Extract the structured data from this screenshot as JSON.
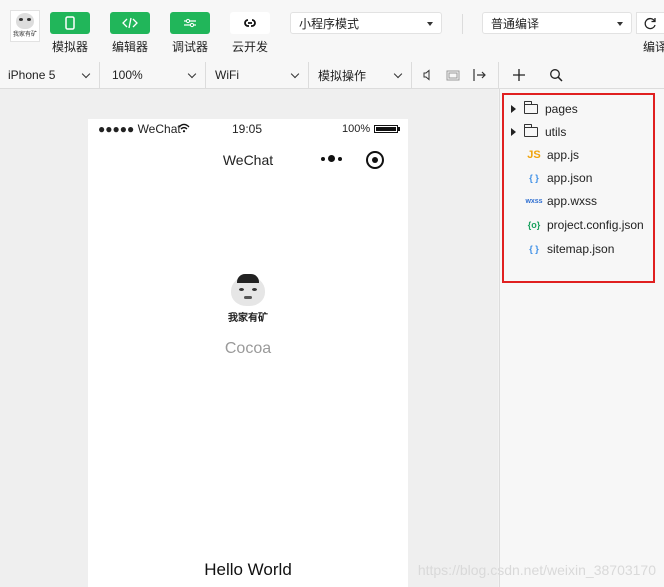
{
  "toolbar": {
    "logo_text": "我家有矿",
    "simulator_label": "模拟器",
    "editor_label": "编辑器",
    "debugger_label": "调试器",
    "cloud_label": "云开发",
    "mode_select": "小程序模式",
    "compile_select": "普通编译",
    "compile_label": "编译"
  },
  "subbar": {
    "device": "iPhone 5",
    "zoom": "100%",
    "network": "WiFi",
    "operation": "模拟操作"
  },
  "phone": {
    "status_carrier": "●●●●● WeChat",
    "status_time": "19:05",
    "status_battery": "100%",
    "nav_title": "WeChat",
    "avatar_text": "我家有矿",
    "nickname": "Cocoa",
    "bottom_text": "Hello World"
  },
  "explorer": {
    "items": [
      {
        "name": "pages",
        "kind": "folder"
      },
      {
        "name": "utils",
        "kind": "folder"
      },
      {
        "name": "app.js",
        "kind": "JS"
      },
      {
        "name": "app.json",
        "kind": "{ }"
      },
      {
        "name": "app.wxss",
        "kind": "wxss"
      },
      {
        "name": "project.config.json",
        "kind": "{o}"
      },
      {
        "name": "sitemap.json",
        "kind": "{ }"
      }
    ]
  },
  "colors": {
    "accent": "#21b65a",
    "highlight_border": "#e02020",
    "js_icon": "#f0a30a",
    "json_icon": "#3b8ee6",
    "wxss_icon": "#2f6fd1",
    "config_icon": "#1aa15f"
  },
  "watermark": "https://blog.csdn.net/weixin_38703170"
}
